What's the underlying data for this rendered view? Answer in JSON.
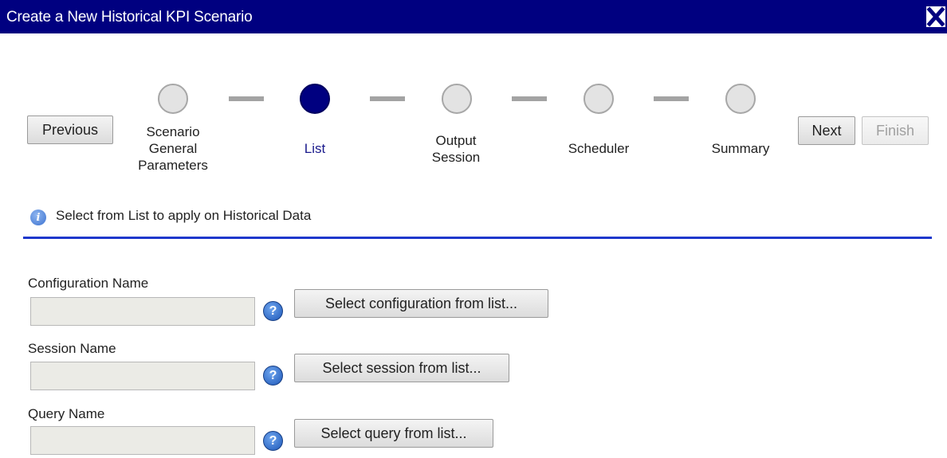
{
  "window": {
    "title": "Create a New Historical KPI Scenario",
    "close_icon": "close-icon"
  },
  "nav": {
    "previous": "Previous",
    "next": "Next",
    "finish": "Finish"
  },
  "wizard": {
    "current_step": 2,
    "steps": [
      {
        "label": "Scenario\nGeneral\nParameters",
        "state": "inactive"
      },
      {
        "label": "List",
        "state": "active"
      },
      {
        "label": "Output\nSession",
        "state": "inactive"
      },
      {
        "label": "Scheduler",
        "state": "inactive"
      },
      {
        "label": "Summary",
        "state": "inactive"
      }
    ]
  },
  "info": {
    "icon": "info-icon",
    "text": "Select from List to apply on Historical Data"
  },
  "fields": {
    "configuration": {
      "label": "Configuration Name",
      "value": "",
      "button": "Select configuration from list..."
    },
    "session": {
      "label": "Session Name",
      "value": "",
      "button": "Select session from list..."
    },
    "query": {
      "label": "Query Name",
      "value": "",
      "button": "Select query from list..."
    }
  },
  "colors": {
    "title_bar": "#000080",
    "active_step": "#000080",
    "divider": "#1e38cc"
  }
}
